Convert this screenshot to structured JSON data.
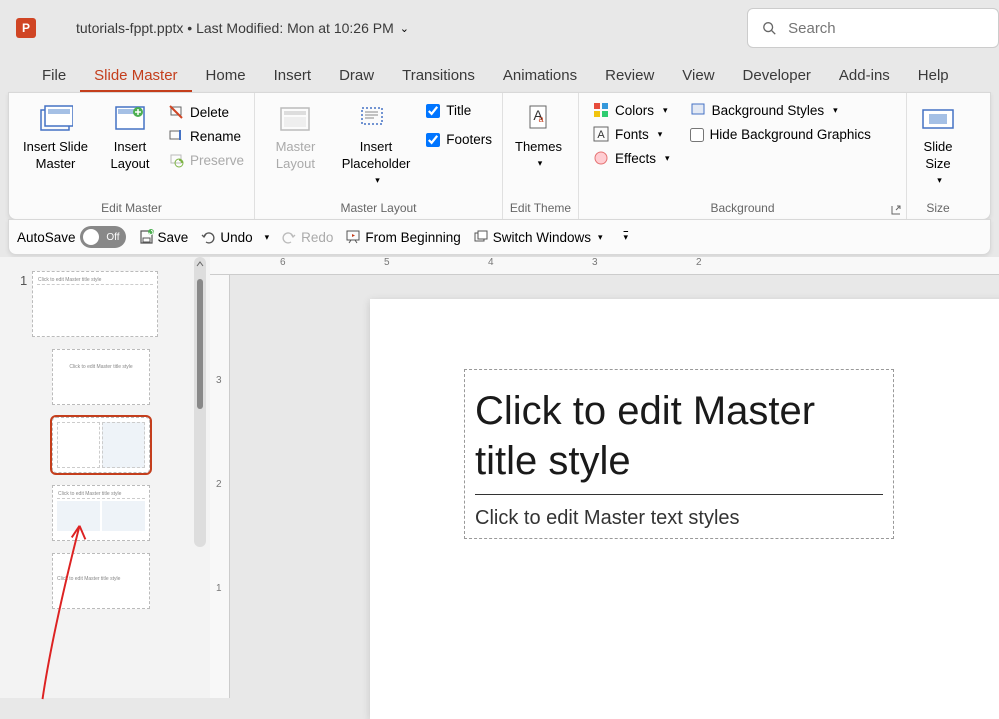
{
  "header": {
    "file_name": "tutorials-fppt.pptx",
    "last_modified": "Last Modified: Mon at 10:26 PM",
    "search_placeholder": "Search"
  },
  "menu": {
    "file": "File",
    "slide_master": "Slide Master",
    "home": "Home",
    "insert": "Insert",
    "draw": "Draw",
    "transitions": "Transitions",
    "animations": "Animations",
    "review": "Review",
    "view": "View",
    "developer": "Developer",
    "addins": "Add-ins",
    "help": "Help"
  },
  "ribbon": {
    "edit_master": {
      "label": "Edit Master",
      "insert_slide_master": "Insert Slide Master",
      "insert_layout": "Insert Layout",
      "delete": "Delete",
      "rename": "Rename",
      "preserve": "Preserve"
    },
    "master_layout": {
      "label": "Master Layout",
      "master_layout_btn": "Master Layout",
      "insert_placeholder": "Insert Placeholder",
      "title": "Title",
      "footers": "Footers"
    },
    "edit_theme": {
      "label": "Edit Theme",
      "themes": "Themes"
    },
    "background": {
      "label": "Background",
      "colors": "Colors",
      "fonts": "Fonts",
      "effects": "Effects",
      "background_styles": "Background Styles",
      "hide_bg": "Hide Background Graphics"
    },
    "size": {
      "label": "Size",
      "slide_size": "Slide Size"
    }
  },
  "qat": {
    "autosave": "AutoSave",
    "autosave_state": "Off",
    "save": "Save",
    "undo": "Undo",
    "redo": "Redo",
    "from_beginning": "From Beginning",
    "switch_windows": "Switch Windows"
  },
  "thumbnails": {
    "number": "1"
  },
  "slide": {
    "title_text": "Click to edit Master title style",
    "subtitle_text": "Click to edit Master text styles"
  },
  "ruler": {
    "h6": "6",
    "h5": "5",
    "h4": "4",
    "h3": "3",
    "h2": "2",
    "v3": "3",
    "v2": "2",
    "v1": "1"
  }
}
